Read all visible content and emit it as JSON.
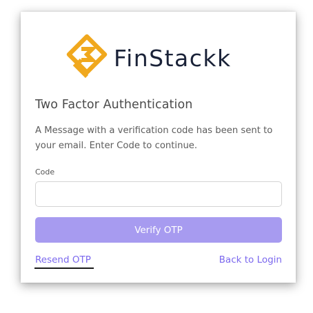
{
  "brand": {
    "name": "FinStackk",
    "logo_icon": "finstackk-logo-icon",
    "logo_color": "#f0a81e"
  },
  "auth": {
    "title": "Two Factor Authentication",
    "description": "A Message with a verification code has been sent to your email. Enter Code to continue.",
    "code_label": "Code",
    "code_value": "",
    "code_placeholder": "",
    "verify_button": "Verify OTP",
    "resend_link": "Resend OTP",
    "back_link": "Back to Login"
  },
  "colors": {
    "accent": "#7b68ee",
    "button": "#a79bf0",
    "brand_text": "#1a2238"
  }
}
